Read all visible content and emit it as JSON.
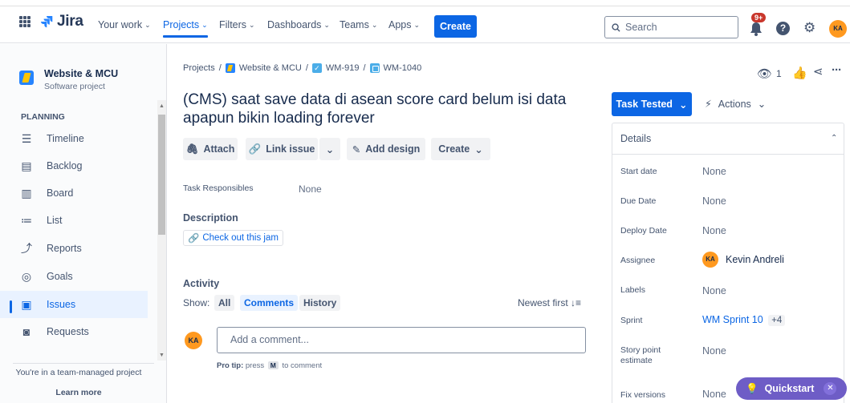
{
  "nav": {
    "logo_text": "Jira",
    "your_work": "Your work",
    "projects": "Projects",
    "filters": "Filters",
    "dashboards": "Dashboards",
    "teams": "Teams",
    "apps": "Apps",
    "create": "Create",
    "search_placeholder": "Search",
    "notifications_badge": "9+",
    "avatar_initials": "KA"
  },
  "sidebar": {
    "project_name": "Website & MCU",
    "project_type": "Software project",
    "section": "PLANNING",
    "items": [
      {
        "label": "Timeline"
      },
      {
        "label": "Backlog"
      },
      {
        "label": "Board"
      },
      {
        "label": "List"
      },
      {
        "label": "Reports"
      },
      {
        "label": "Goals"
      },
      {
        "label": "Issues"
      },
      {
        "label": "Requests"
      }
    ],
    "team_note": "You're in a team-managed project",
    "learn_more": "Learn more"
  },
  "breadcrumb": {
    "projects": "Projects",
    "project": "Website & MCU",
    "parent": "WM-919",
    "issue": "WM-1040"
  },
  "issue": {
    "title": "(CMS) saat save data di asean score card belum isi data apapun bikin loading forever",
    "toolbar": {
      "attach": "Attach",
      "link_issue": "Link issue",
      "add_design": "Add design",
      "create": "Create"
    },
    "task_responsibles_label": "Task Responsibles",
    "task_responsibles_value": "None",
    "description_label": "Description",
    "description_link": "Check out this jam"
  },
  "activity": {
    "heading": "Activity",
    "show_label": "Show:",
    "tabs": [
      "All",
      "Comments",
      "History"
    ],
    "sort": "Newest first",
    "comment_placeholder": "Add a comment...",
    "protip_prefix": "Pro tip:",
    "protip_press": "press",
    "protip_key": "M",
    "protip_suffix": "to comment",
    "avatar_initials": "KA"
  },
  "right_panel": {
    "watch_count": "1",
    "status": "Task Tested",
    "actions": "Actions",
    "details_title": "Details",
    "fields": [
      {
        "label": "Start date",
        "value": "None"
      },
      {
        "label": "Due Date",
        "value": "None"
      },
      {
        "label": "Deploy Date",
        "value": "None"
      },
      {
        "label": "Assignee",
        "value": "Kevin Andreli"
      },
      {
        "label": "Labels",
        "value": "None"
      },
      {
        "label": "Sprint",
        "value": "WM Sprint 10",
        "extra": "+4"
      },
      {
        "label": "Story point estimate",
        "value": "None"
      },
      {
        "label": "Fix versions",
        "value": "None"
      }
    ],
    "assignee_initials": "KA"
  },
  "quickstart": {
    "label": "Quickstart"
  }
}
